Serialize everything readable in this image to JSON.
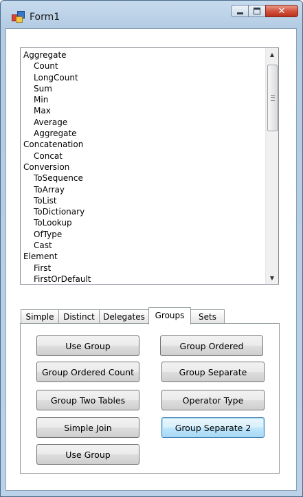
{
  "window": {
    "title": "Form1",
    "close_glyph": "✕"
  },
  "listbox": {
    "items": [
      {
        "label": "Aggregate",
        "level": 0
      },
      {
        "label": "Count",
        "level": 1
      },
      {
        "label": "LongCount",
        "level": 1
      },
      {
        "label": "Sum",
        "level": 1
      },
      {
        "label": "Min",
        "level": 1
      },
      {
        "label": "Max",
        "level": 1
      },
      {
        "label": "Average",
        "level": 1
      },
      {
        "label": "Aggregate",
        "level": 1
      },
      {
        "label": "Concatenation",
        "level": 0
      },
      {
        "label": "Concat",
        "level": 1
      },
      {
        "label": "Conversion",
        "level": 0
      },
      {
        "label": "ToSequence",
        "level": 1
      },
      {
        "label": "ToArray",
        "level": 1
      },
      {
        "label": "ToList",
        "level": 1
      },
      {
        "label": "ToDictionary",
        "level": 1
      },
      {
        "label": "ToLookup",
        "level": 1
      },
      {
        "label": "OfType",
        "level": 1
      },
      {
        "label": "Cast",
        "level": 1
      },
      {
        "label": "Element",
        "level": 0
      },
      {
        "label": "First",
        "level": 1
      },
      {
        "label": "FirstOrDefault",
        "level": 1
      }
    ],
    "scroll_up_glyph": "▲",
    "scroll_down_glyph": "▼"
  },
  "tabs": [
    {
      "label": "Simple",
      "active": false
    },
    {
      "label": "Distinct",
      "active": false
    },
    {
      "label": "Delegates",
      "active": false
    },
    {
      "label": "Groups",
      "active": true
    },
    {
      "label": "Sets",
      "active": false
    }
  ],
  "buttons": {
    "use_group_1": "Use Group",
    "group_ordered": "Group Ordered",
    "group_ordered_count": "Group Ordered Count",
    "group_separate": "Group Separate",
    "group_two_tables": "Group Two Tables",
    "operator_type": "Operator Type",
    "simple_join": "Simple Join",
    "group_separate_2": "Group Separate 2",
    "use_group_2": "Use Group"
  }
}
